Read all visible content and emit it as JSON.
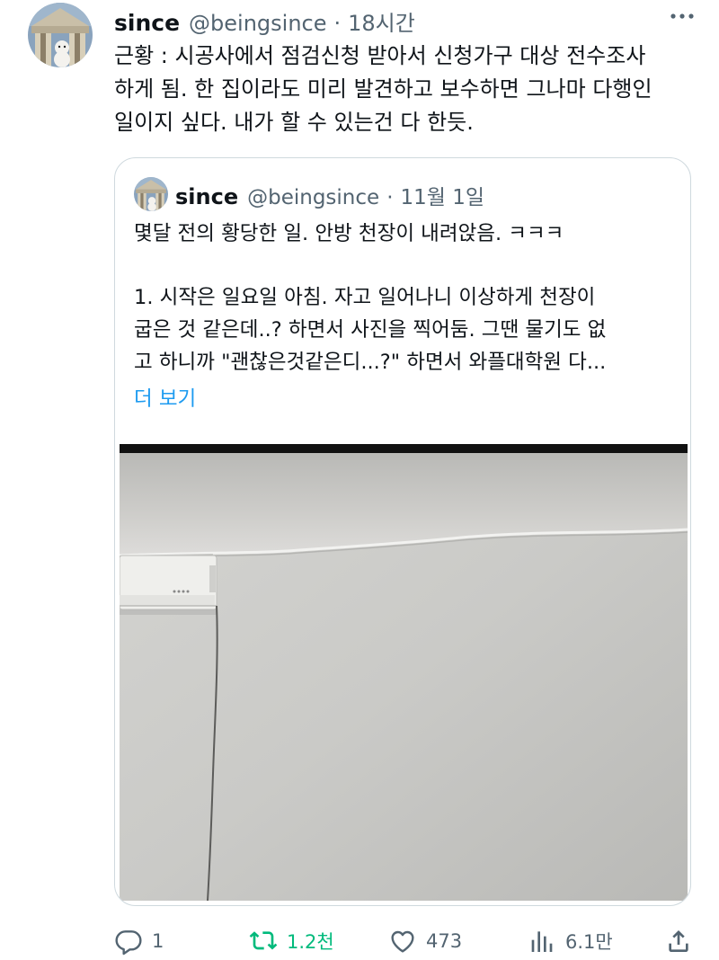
{
  "tweet": {
    "author": {
      "name": "since",
      "handle": "@beingsince"
    },
    "separator": "·",
    "time": "18시간",
    "text_lines": [
      "근황 : 시공사에서 점검신청 받아서 신청가구 대상 전수조사",
      "하게 됨. 한 집이라도 미리 발견하고 보수하면 그나마 다행인",
      "일이지 싶다. 내가 할 수 있는건 다 한듯."
    ],
    "more_icon": "more-horizontal-icon"
  },
  "quote": {
    "author": {
      "name": "since",
      "handle": "@beingsince"
    },
    "separator": "·",
    "date": "11월 1일",
    "lines": [
      "몇달 전의 황당한 일. 안방 천장이 내려앉음. ㅋㅋㅋ",
      "1. 시작은 일요일 아침. 자고 일어나니 이상하게 천장이",
      "굽은 것 같은데..? 하면서 사진을 찍어둠. 그땐 물기도 없",
      "고 하니까 \"괜찮은것같은디...?\" 하면서 와플대학원 다..."
    ],
    "show_more": "더 보기",
    "photo_description": "ceiling-sag-photo"
  },
  "actions": {
    "reply": {
      "icon": "reply-icon",
      "count": "1"
    },
    "retweet": {
      "icon": "retweet-icon",
      "count": "1.2천"
    },
    "like": {
      "icon": "heart-icon",
      "count": "473"
    },
    "views": {
      "icon": "views-icon",
      "count": "6.1만"
    },
    "share": {
      "icon": "share-icon"
    }
  },
  "colors": {
    "text": "#0f1419",
    "secondary": "#536471",
    "link": "#1d9bf0",
    "retweet": "#00ba7c",
    "border": "#cfd9de"
  }
}
